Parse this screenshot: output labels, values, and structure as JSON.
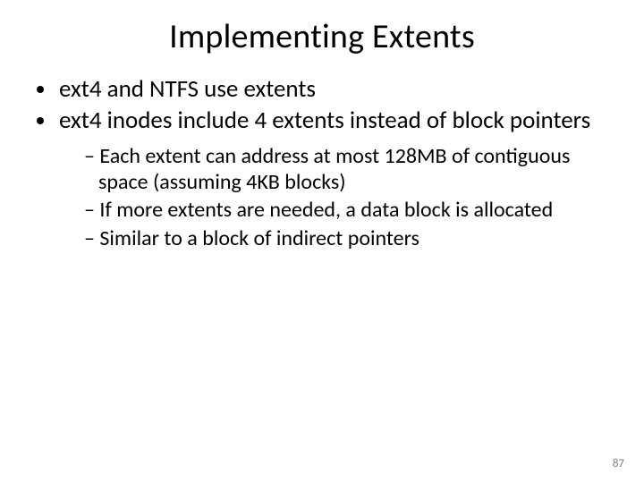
{
  "title": "Implementing Extents",
  "bullets_level1": [
    "ext4 and NTFS use extents",
    "ext4 inodes include 4 extents instead of block pointers"
  ],
  "bullets_level2": [
    "Each extent can address at most 128MB of contiguous space (assuming 4KB blocks)",
    "If more extents are needed, a data block is allocated",
    "Similar to a block of indirect pointers"
  ],
  "page_number": "87"
}
